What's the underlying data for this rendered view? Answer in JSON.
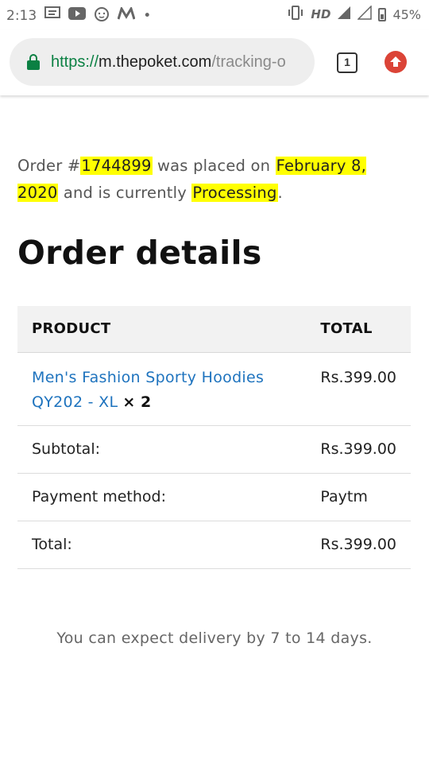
{
  "status_bar": {
    "time": "2:13",
    "network": "HD",
    "battery": "45%"
  },
  "browser": {
    "url_scheme": "https://",
    "url_host": "m.thepoket.com",
    "url_path": "/tracking-o",
    "tab_count": "1"
  },
  "order": {
    "prefix": "Order #",
    "number": "1744899",
    "placed_text": " was placed on ",
    "date": "February 8, 2020",
    "status_text": " and is currently ",
    "status": "Processing",
    "end": "."
  },
  "details": {
    "title": "Order details",
    "headers": {
      "product": "PRODUCT",
      "total": "TOTAL"
    },
    "item": {
      "name": "Men's Fashion Sporty Hoodies QY202 - XL",
      "qty": "× 2",
      "total": "Rs.399.00"
    },
    "rows": [
      {
        "label": "Subtotal:",
        "value": "Rs.399.00"
      },
      {
        "label": "Payment method:",
        "value": "Paytm"
      },
      {
        "label": "Total:",
        "value": "Rs.399.00"
      }
    ]
  },
  "delivery_note": "You can expect delivery by 7 to 14 days.",
  "colors": {
    "highlight": "#ffff00",
    "link": "#1e73be",
    "secure": "#0b8043",
    "update": "#db4437"
  }
}
